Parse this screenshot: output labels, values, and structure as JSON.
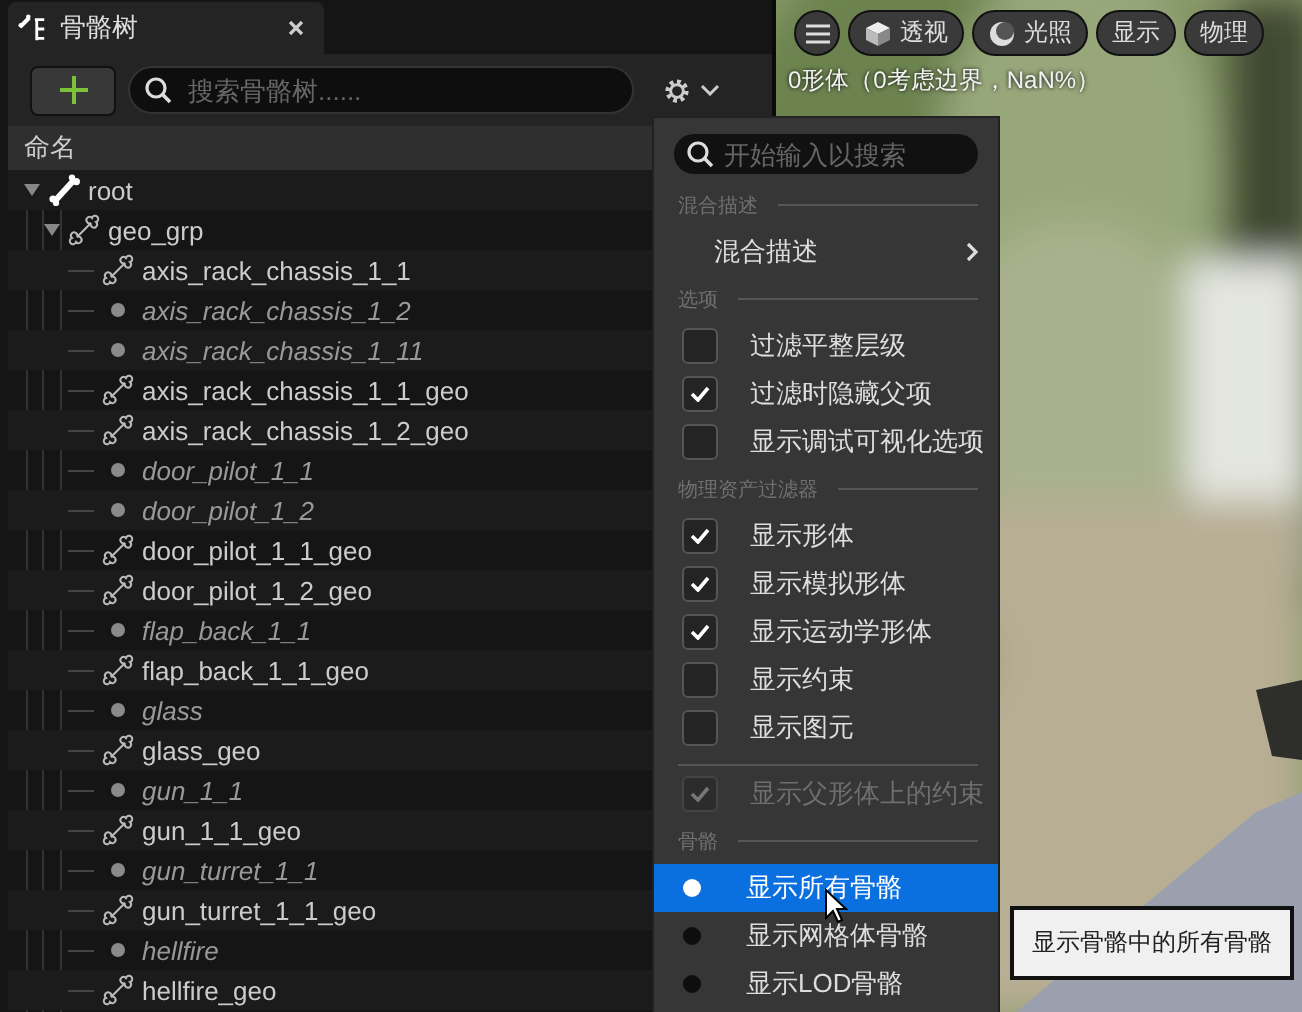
{
  "tab": {
    "title": "骨骼树"
  },
  "toolbar": {
    "search_placeholder": "搜索骨骼树......"
  },
  "tree": {
    "column": "命名",
    "items": [
      {
        "name": "root",
        "kind": "solid",
        "expanded": true,
        "children": [
          {
            "name": "geo_grp",
            "kind": "outline",
            "expanded": true,
            "children": [
              {
                "name": "axis_rack_chassis_1_1",
                "kind": "outline"
              },
              {
                "name": "axis_rack_chassis_1_2",
                "kind": "dot"
              },
              {
                "name": "axis_rack_chassis_1_11",
                "kind": "dot"
              },
              {
                "name": "axis_rack_chassis_1_1_geo",
                "kind": "outline"
              },
              {
                "name": "axis_rack_chassis_1_2_geo",
                "kind": "outline"
              },
              {
                "name": "door_pilot_1_1",
                "kind": "dot"
              },
              {
                "name": "door_pilot_1_2",
                "kind": "dot"
              },
              {
                "name": "door_pilot_1_1_geo",
                "kind": "outline"
              },
              {
                "name": "door_pilot_1_2_geo",
                "kind": "outline"
              },
              {
                "name": "flap_back_1_1",
                "kind": "dot"
              },
              {
                "name": "flap_back_1_1_geo",
                "kind": "outline"
              },
              {
                "name": "glass",
                "kind": "dot"
              },
              {
                "name": "glass_geo",
                "kind": "outline"
              },
              {
                "name": "gun_1_1",
                "kind": "dot"
              },
              {
                "name": "gun_1_1_geo",
                "kind": "outline"
              },
              {
                "name": "gun_turret_1_1",
                "kind": "dot"
              },
              {
                "name": "gun_turret_1_1_geo",
                "kind": "outline"
              },
              {
                "name": "hellfire",
                "kind": "dot"
              },
              {
                "name": "hellfire_geo",
                "kind": "outline"
              }
            ]
          }
        ]
      }
    ]
  },
  "viewport": {
    "buttons": [
      {
        "kind": "menu"
      },
      {
        "kind": "cube",
        "label": "透视"
      },
      {
        "kind": "sphere",
        "label": "光照"
      },
      {
        "kind": "text",
        "label": "显示"
      },
      {
        "kind": "text",
        "label": "物理"
      }
    ],
    "stats": [
      "0形体（0考虑边界，NaN%）"
    ]
  },
  "menu": {
    "search_placeholder": "开始输入以搜索",
    "sections": [
      {
        "title": "混合描述",
        "items": [
          {
            "kind": "submenu",
            "label": "混合描述"
          }
        ]
      },
      {
        "title": "选项",
        "items": [
          {
            "kind": "checkbox",
            "label": "过滤平整层级",
            "checked": false,
            "disabled": false
          },
          {
            "kind": "checkbox",
            "label": "过滤时隐藏父项",
            "checked": true,
            "disabled": false
          },
          {
            "kind": "checkbox",
            "label": "显示调试可视化选项",
            "checked": false,
            "disabled": false
          }
        ]
      },
      {
        "title": "物理资产过滤器",
        "items": [
          {
            "kind": "checkbox",
            "label": "显示形体",
            "checked": true,
            "disabled": false
          },
          {
            "kind": "checkbox",
            "label": "显示模拟形体",
            "checked": true,
            "disabled": false
          },
          {
            "kind": "checkbox",
            "label": "显示运动学形体",
            "checked": true,
            "disabled": false
          },
          {
            "kind": "checkbox",
            "label": "显示约束",
            "checked": false,
            "disabled": false
          },
          {
            "kind": "checkbox",
            "label": "显示图元",
            "checked": false,
            "disabled": false
          },
          {
            "kind": "divider"
          },
          {
            "kind": "checkbox",
            "label": "显示父形体上的约束",
            "checked": true,
            "disabled": true
          }
        ]
      },
      {
        "title": "骨骼",
        "items": [
          {
            "kind": "radio",
            "label": "显示所有骨骼",
            "selected": true
          },
          {
            "kind": "radio",
            "label": "显示网格体骨骼",
            "selected": false
          },
          {
            "kind": "radio",
            "label": "显示LOD骨骼",
            "selected": false
          }
        ]
      }
    ]
  },
  "tooltip": "显示骨骼中的所有骨骼"
}
